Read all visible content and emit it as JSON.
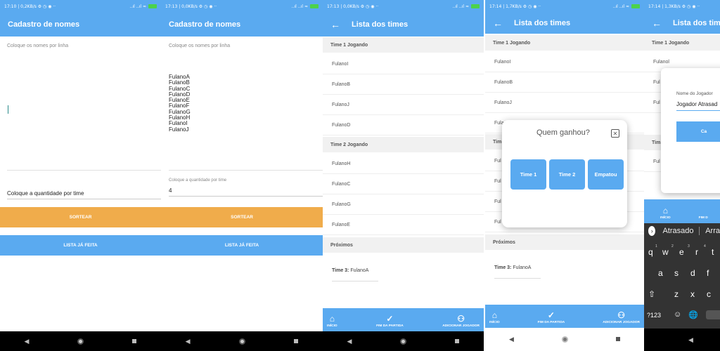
{
  "screens": [
    {
      "status": {
        "left": "17:10 | 0,2KB/s ⚙ ◷ ◉  ··",
        "right": "‥ıl ‥ıl ≈"
      },
      "appbar_title": "Cadastro de nomes",
      "names_placeholder": "Coloque os nomes por linha",
      "names_text": "",
      "qty_label": "Coloque a quantidade por time",
      "qty_value": "",
      "sortear_label": "SORTEAR",
      "lista_label": "LISTA JÁ FEITA"
    },
    {
      "status": {
        "left": "17:13 | 0,0KB/s ⚙ ◷ ◉  ··",
        "right": "‥ıl ‥ıl ≈"
      },
      "appbar_title": "Cadastro de nomes",
      "names_placeholder": "Coloque os nomes por linha",
      "names_text": "FulanoA\nFulanoB\nFulanoC\nFulanoD\nFulanoE\nFulanoF\nFulanoG\nFulanoH\nFulanoI\nFulanoJ",
      "qty_label": "Coloque a quantidade por time",
      "qty_value": "4",
      "sortear_label": "SORTEAR",
      "lista_label": "LISTA JÁ FEITA"
    },
    {
      "status": {
        "left": "17:13 | 0,0KB/s ⚙ ◷ ◉  ··",
        "right": "‥ıl ‥ıl ≈"
      },
      "appbar_title": "Lista dos times",
      "team1_header": "Time 1  Jogando",
      "team1": [
        "FulanoI",
        "FulanoB",
        "FulanoJ",
        "FulanoD"
      ],
      "team2_header": "Time 2  Jogando",
      "team2": [
        "FulanoH",
        "FulanoC",
        "FulanoG",
        "FulanoE"
      ],
      "next_header": "Próximos",
      "next_label": "Time 3:",
      "next_value": "FulanoA",
      "nav": [
        "INÍCIO",
        "FIM DA PARTIDA",
        "ADICIONAR JOGADOR"
      ]
    },
    {
      "status": {
        "left": "17:14 | 1,7KB/s ⚙ ◷ ◉  ··",
        "right": "‥ıl ‥ıl ≈"
      },
      "appbar_title": "Lista dos times",
      "team1_header": "Time 1  Jogando",
      "team1": [
        "FulanoI",
        "FulanoB",
        "FulanoJ",
        "Fula"
      ],
      "team2_header": "Tim",
      "team2": [
        "Ful",
        "Ful",
        "Ful",
        "Ful"
      ],
      "next_header": "Próximos",
      "next_label": "Time 3:",
      "next_value": "FulanoA",
      "nav": [
        "INÍCIO",
        "FIM DA PARTIDA",
        "ADICIONAR JOGADOR"
      ],
      "dialog_title": "Quem ganhou?",
      "dialog_buttons": [
        "Time 1",
        "Time 2",
        "Empatou"
      ]
    },
    {
      "status": {
        "left": "17:14 | 1,3KB/s ⚙ ◷ ◉  ··",
        "right": ""
      },
      "appbar_title": "Lista dos times",
      "team1_header": "Time 1  Jogando",
      "team1": [
        "Fulanol",
        "Ful",
        "Ful"
      ],
      "team2_header": "Tim",
      "team2": [
        "Ful"
      ],
      "dialog_label": "Nome do Jogador",
      "dialog_value": "Jogador Atrasad",
      "dialog_button": "Ca",
      "nav": [
        "INÍCIO",
        "FIM D"
      ],
      "suggestions": [
        "Atrasado",
        "Arra"
      ],
      "keys_row1": [
        "q",
        "w",
        "e",
        "r",
        "t"
      ],
      "keys_row1_sup": [
        "1",
        "2",
        "3",
        "4"
      ],
      "keys_row2": [
        "a",
        "s",
        "d",
        "f"
      ],
      "keys_row3": [
        "⇧",
        "z",
        "x",
        "c"
      ],
      "keys_row4": [
        "?123",
        "☺",
        "🌐"
      ]
    }
  ],
  "colors": {
    "primary": "#5aaaf0",
    "orange": "#f0ac4b",
    "battery": "#4cd24c"
  }
}
